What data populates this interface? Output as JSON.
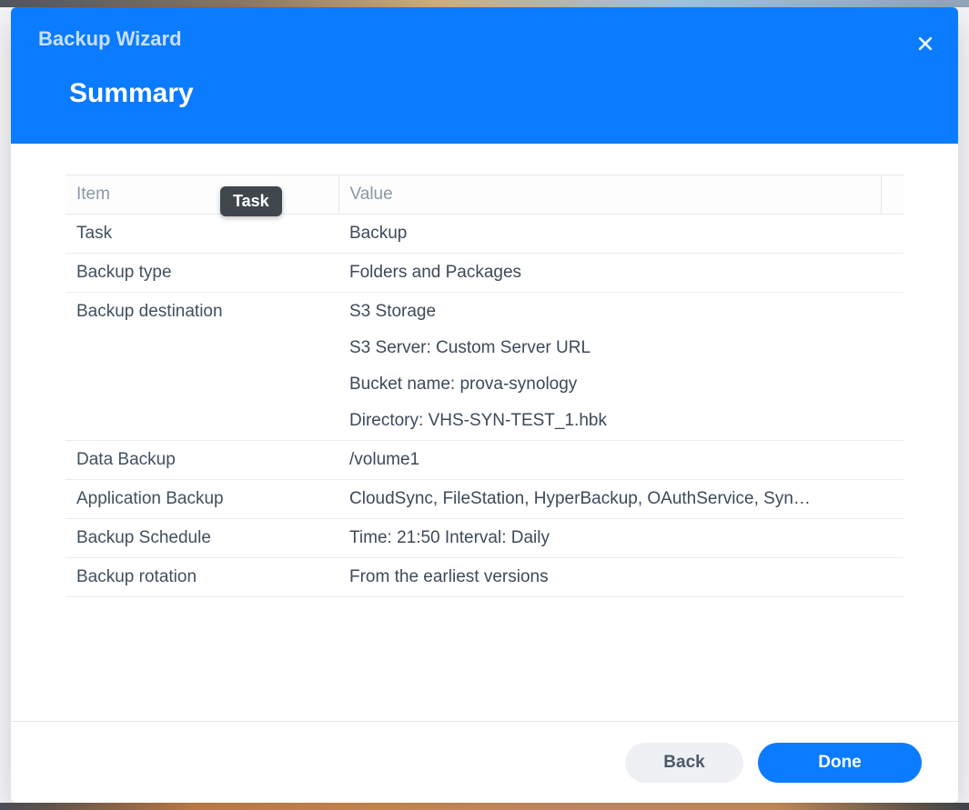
{
  "wizard": {
    "title": "Backup Wizard",
    "step_title": "Summary"
  },
  "table": {
    "header_item": "Item",
    "header_value": "Value",
    "rows": [
      {
        "item": "Task",
        "value": "Backup"
      },
      {
        "item": "Backup type",
        "value": "Folders and Packages"
      },
      {
        "item": "Backup destination",
        "value": "S3 Storage",
        "extra": [
          "S3 Server: Custom Server URL",
          "Bucket name: prova-synology",
          "Directory: VHS-SYN-TEST_1.hbk"
        ]
      },
      {
        "item": "Data Backup",
        "value": "/volume1"
      },
      {
        "item": "Application Backup",
        "value": "CloudSync, FileStation, HyperBackup, OAuthService, Syn…"
      },
      {
        "item": "Backup Schedule",
        "value": "Time: 21:50 Interval: Daily"
      },
      {
        "item": "Backup rotation",
        "value": "From the earliest versions"
      }
    ]
  },
  "tooltip": {
    "text": "Task"
  },
  "buttons": {
    "back": "Back",
    "done": "Done"
  },
  "icons": {
    "close": "close-icon"
  },
  "colors": {
    "accent": "#0b7bff"
  }
}
